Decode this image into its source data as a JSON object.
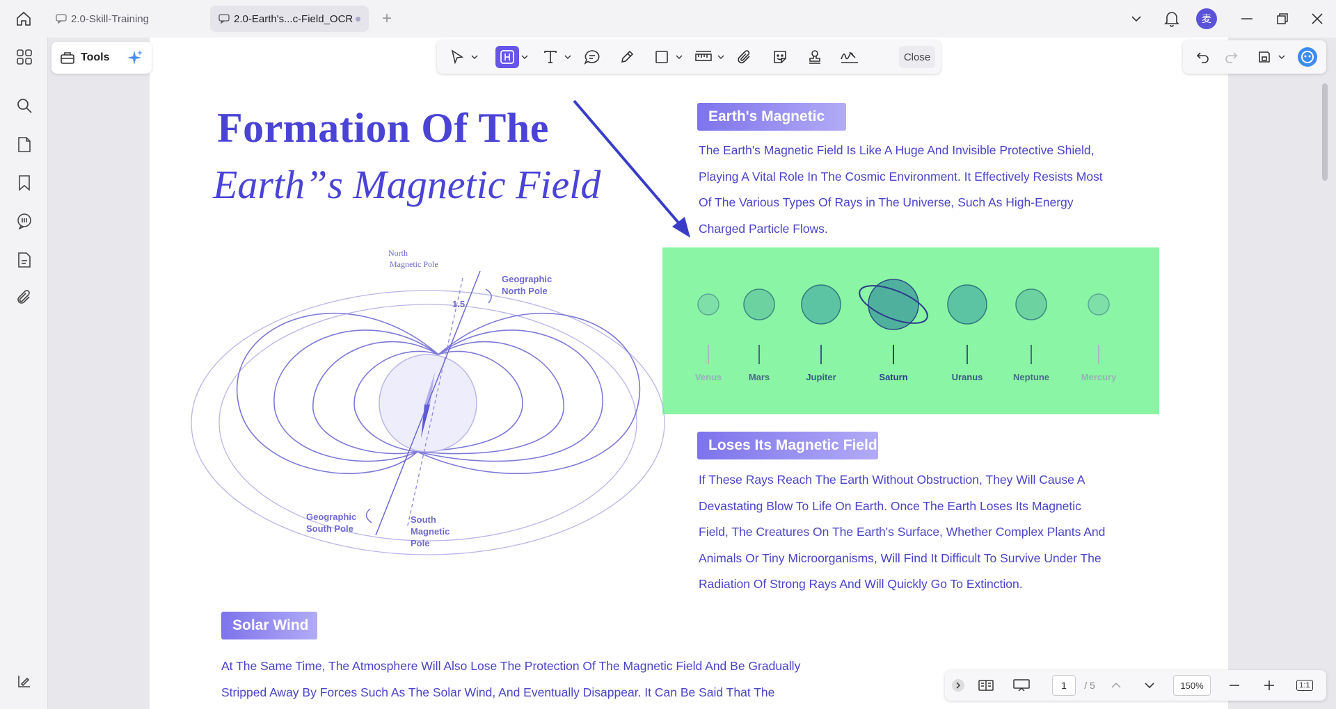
{
  "tabs": [
    {
      "label": "2.0-Skill-Training"
    },
    {
      "label": "2.0-Earth's...c-Field_OCR"
    }
  ],
  "avatar": {
    "text": "麦"
  },
  "toolbar": {
    "tools_label": "Tools",
    "close_label": "Close"
  },
  "document": {
    "title_line1": "Formation Of The",
    "title_line2": "Earth”s Magnetic Field",
    "section1": {
      "heading": "Earth's Magnetic",
      "lines": [
        "The Earth's Magnetic Field Is Like A Huge And Invisible Protective Shield,",
        "Playing A Vital Role In The Cosmic Environment. It Effectively Resists Most",
        "Of The Various Types Of Rays in The Universe, Such As High-Energy",
        "Charged Particle Flows."
      ]
    },
    "section2": {
      "heading": "Loses Its Magnetic Field",
      "lines": [
        "If These Rays Reach The Earth Without Obstruction, They Will Cause A",
        "Devastating Blow To Life On Earth. Once The Earth Loses Its Magnetic",
        "Field, The Creatures On The Earth's Surface, Whether Complex Plants And",
        "Animals Or Tiny Microorganisms, Will Find It Difficult To Survive Under The",
        "Radiation Of Strong Rays And Will Quickly Go To Extinction."
      ]
    },
    "section3": {
      "heading": "Solar Wind",
      "lines": [
        "At The Same Time, The Atmosphere Will Also Lose The Protection Of The Magnetic Field And Be Gradually",
        "Stripped Away By Forces Such As The Solar Wind, And Eventually Disappear. It Can Be Said That The"
      ]
    },
    "diagram": {
      "north_magnetic_pole": [
        "North",
        "Magnetic Pole"
      ],
      "geographic_north_pole": [
        "Geographic",
        "North Pole"
      ],
      "geographic_south_pole": [
        "Geographic",
        "South Pole"
      ],
      "south_magnetic_pole": [
        "South",
        "Magnetic",
        "Pole"
      ],
      "angle": "1.5"
    },
    "planets": [
      {
        "name": "Venus"
      },
      {
        "name": "Mars"
      },
      {
        "name": "Jupiter"
      },
      {
        "name": "Saturn"
      },
      {
        "name": "Uranus"
      },
      {
        "name": "Neptune"
      },
      {
        "name": "Mercury"
      }
    ],
    "colors": {
      "accent": "#4a43d6",
      "highlight": "#8af5a4",
      "badge": "#7d73ec"
    }
  },
  "status": {
    "page_current": "1",
    "page_total": "/ 5",
    "zoom": "150%",
    "fit_label": "1:1"
  }
}
